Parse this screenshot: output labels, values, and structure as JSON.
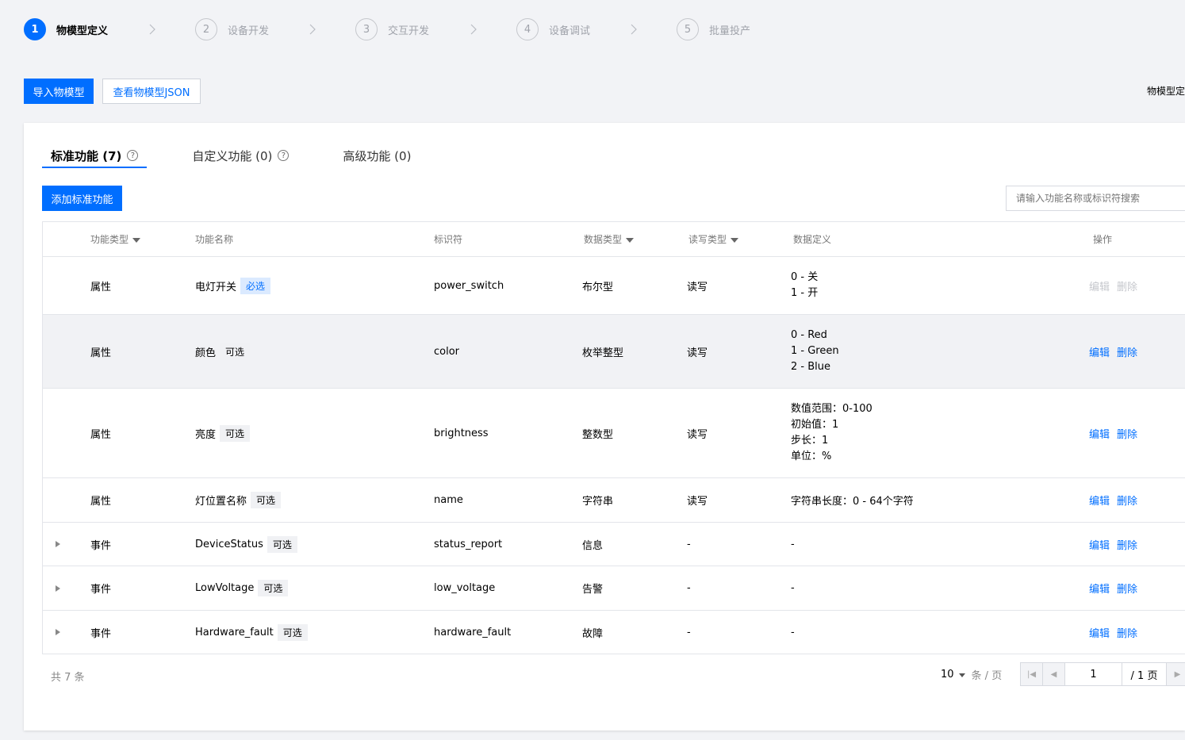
{
  "steps": [
    {
      "num": "1",
      "label": "物模型定义"
    },
    {
      "num": "2",
      "label": "设备开发"
    },
    {
      "num": "3",
      "label": "交互开发"
    },
    {
      "num": "4",
      "label": "设备调试"
    },
    {
      "num": "5",
      "label": "批量投产"
    }
  ],
  "toolbar": {
    "import_label": "导入物模型",
    "view_json_label": "查看物模型JSON",
    "right_text": "物模型定"
  },
  "tabs": [
    {
      "label": "标准功能 (7)"
    },
    {
      "label": "自定义功能 (0)"
    },
    {
      "label": "高级功能 (0)"
    }
  ],
  "add_button_label": "添加标准功能",
  "search": {
    "placeholder": "请输入功能名称或标识符搜索"
  },
  "columns": {
    "type": "功能类型",
    "name": "功能名称",
    "identifier": "标识符",
    "data_type": "数据类型",
    "rw_type": "读写类型",
    "definition": "数据定义",
    "actions": "操作"
  },
  "rows": [
    {
      "type": "属性",
      "name": "电灯开关",
      "tag": "必选",
      "identifier": "power_switch",
      "data_type": "布尔型",
      "rw": "读写",
      "def": [
        "0 - 关",
        "1 - 开"
      ],
      "edit": "编辑",
      "delete": "删除"
    },
    {
      "type": "属性",
      "name": "颜色",
      "tag": "可选",
      "identifier": "color",
      "data_type": "枚举整型",
      "rw": "读写",
      "def": [
        "0 - Red",
        "1 - Green",
        "2 - Blue"
      ],
      "edit": "编辑",
      "delete": "删除"
    },
    {
      "type": "属性",
      "name": "亮度",
      "tag": "可选",
      "identifier": "brightness",
      "data_type": "整数型",
      "rw": "读写",
      "def": [
        "数值范围：0-100",
        "初始值：1",
        "步长：1",
        "单位：%"
      ],
      "edit": "编辑",
      "delete": "删除"
    },
    {
      "type": "属性",
      "name": "灯位置名称",
      "tag": "可选",
      "identifier": "name",
      "data_type": "字符串",
      "rw": "读写",
      "def": [
        "字符串长度：0 - 64个字符"
      ],
      "edit": "编辑",
      "delete": "删除"
    },
    {
      "type": "事件",
      "name": "DeviceStatus",
      "tag": "可选",
      "identifier": "status_report",
      "data_type": "信息",
      "rw": "-",
      "def": [
        "-"
      ],
      "edit": "编辑",
      "delete": "删除"
    },
    {
      "type": "事件",
      "name": "LowVoltage",
      "tag": "可选",
      "identifier": "low_voltage",
      "data_type": "告警",
      "rw": "-",
      "def": [
        "-"
      ],
      "edit": "编辑",
      "delete": "删除"
    },
    {
      "type": "事件",
      "name": "Hardware_fault",
      "tag": "可选",
      "identifier": "hardware_fault",
      "data_type": "故障",
      "rw": "-",
      "def": [
        "-"
      ],
      "edit": "编辑",
      "delete": "删除"
    }
  ],
  "footer": {
    "total": "共 7 条",
    "page_size": "10",
    "page_size_unit": "条 / 页",
    "current_page": "1",
    "total_pages": "/ 1 页"
  },
  "colors": {
    "accent": "#006eff",
    "background": "#f2f3f6",
    "required_tag_bg": "#dbeaff"
  }
}
